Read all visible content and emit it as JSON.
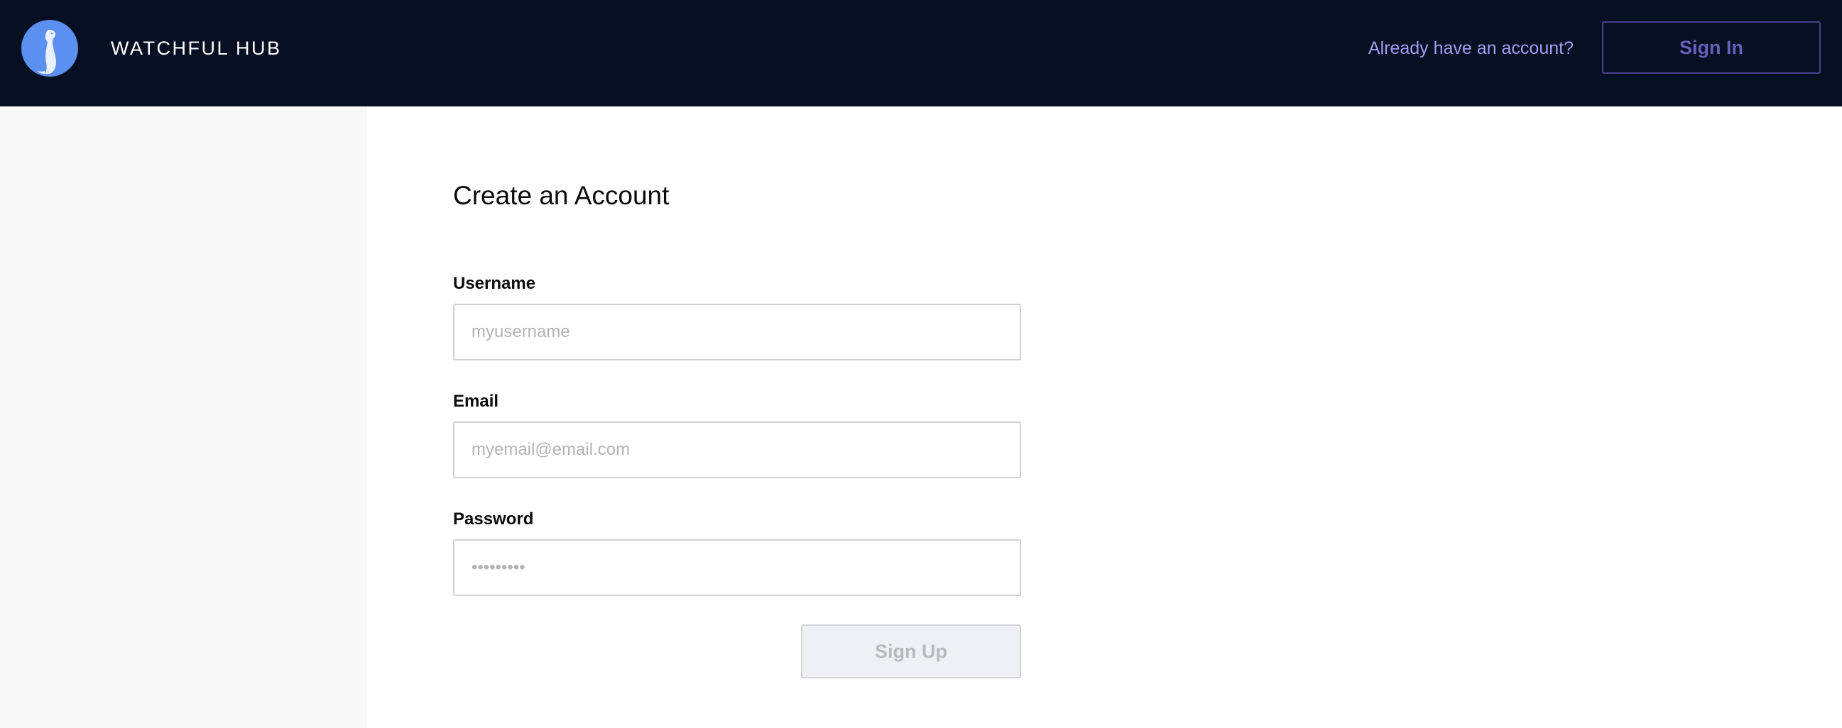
{
  "header": {
    "brand": "WATCHFUL HUB",
    "logo_icon": "meerkat-logo-icon",
    "already_text": "Already have an account?",
    "signin_label": "Sign In"
  },
  "form": {
    "title": "Create an Account",
    "username": {
      "label": "Username",
      "placeholder": "myusername",
      "value": ""
    },
    "email": {
      "label": "Email",
      "placeholder": "myemail@email.com",
      "value": ""
    },
    "password": {
      "label": "Password",
      "placeholder": "•••••••••",
      "value": ""
    },
    "submit_label": "Sign Up",
    "submit_disabled": true
  },
  "colors": {
    "topbar": "#070f22",
    "logo_bg": "#5b8ff0",
    "link": "#a29cf2",
    "signin_border": "#46418f",
    "signin_text": "#6560b9",
    "sidebar_bg": "#f8f8f8",
    "button_disabled_bg": "#eff0f3",
    "button_disabled_text": "#b9b9bc"
  }
}
